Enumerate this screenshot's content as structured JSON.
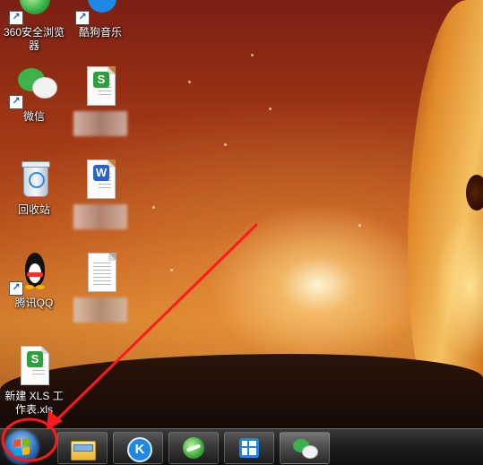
{
  "desktop": {
    "icons": [
      {
        "label": "360安全浏览器"
      },
      {
        "label": "酷狗音乐"
      },
      {
        "label": "微信"
      },
      {
        "label": "回收站"
      },
      {
        "label": "腾讯QQ"
      },
      {
        "label": "新建 XLS 工作表.xls"
      }
    ],
    "blurred_filenames": [
      {
        "ext": "xls"
      },
      {
        "ext": "docx"
      },
      {
        "ext": "txt"
      }
    ]
  },
  "taskbar": {
    "start_button": {
      "icon": "windows-logo-icon"
    },
    "pinned": [
      {
        "name": "file-explorer",
        "icon": "folder-icon"
      },
      {
        "name": "kugou-music",
        "icon": "kugou-icon"
      },
      {
        "name": "360-browser",
        "icon": "browser-icon"
      },
      {
        "name": "app-grid",
        "icon": "grid-app-icon"
      },
      {
        "name": "wechat",
        "icon": "wechat-icon",
        "active": true
      }
    ]
  },
  "annotation": {
    "color": "#ff1a1a"
  }
}
